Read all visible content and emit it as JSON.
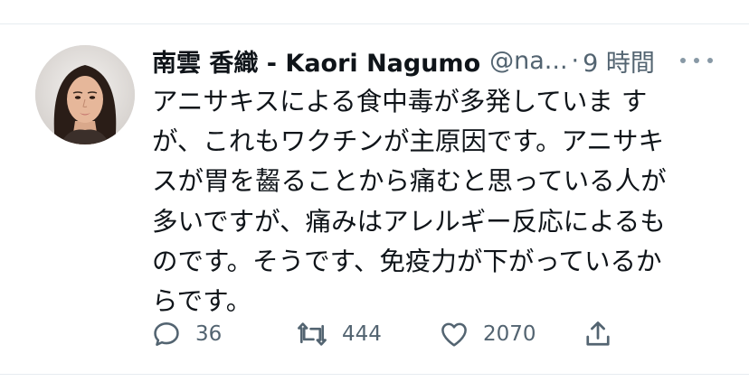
{
  "tweet": {
    "author_name": "南雲 香織 - Kaori Nagumo",
    "handle": "@na...",
    "separator": "·",
    "time": "9 時間",
    "text_lines": [
      "アニサキスによる食中毒が多発していま す",
      "が、これもワクチンが主原因です。アニサキ",
      "スが胃を齧ることから痛むと思っている人が",
      "多いですが、痛みはアレルギー反応によるも",
      "のです。そうです、免疫力が下がっているか",
      "らです。"
    ]
  },
  "actions": {
    "reply_count": "36",
    "retweet_count": "444",
    "like_count": "2070"
  },
  "icons": {
    "reply": "reply-icon",
    "retweet": "retweet-icon",
    "like": "heart-icon",
    "share": "share-icon",
    "more": "more-icon"
  },
  "colors": {
    "text": "#0f1419",
    "secondary": "#536471",
    "icon": "#536471",
    "divider": "#e6ecf0"
  }
}
